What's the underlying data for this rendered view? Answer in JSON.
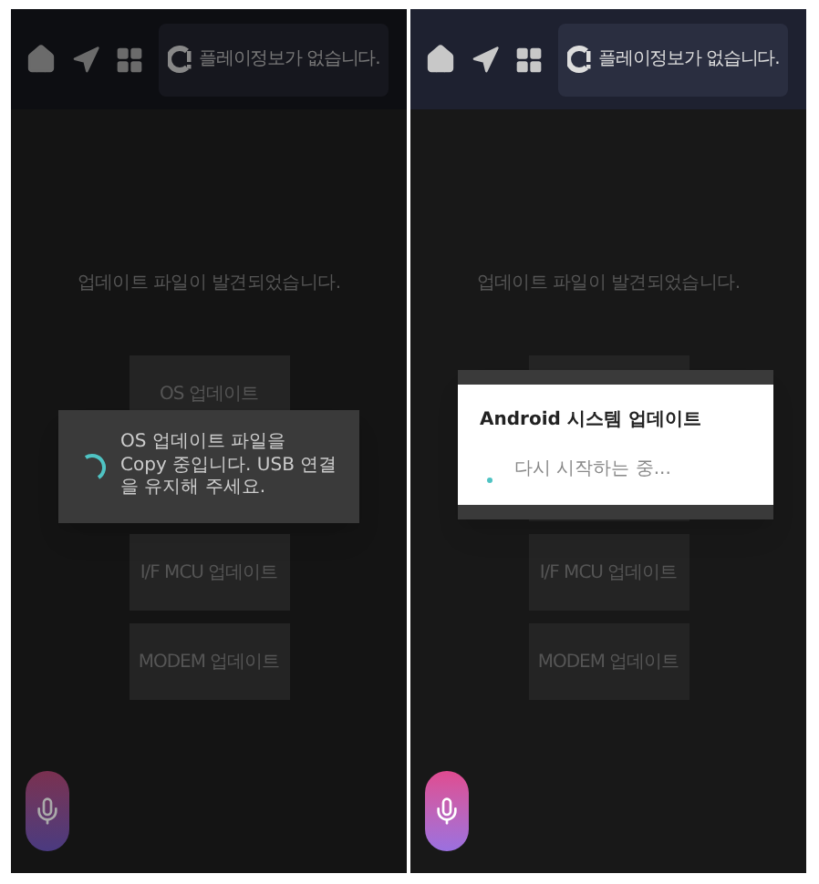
{
  "panels": [
    {
      "dimmed": true,
      "status": "플레이정보가 없습니다.",
      "message": "업데이트 파일이 발견되었습니다.",
      "buttons": [
        {
          "label": "OS 업데이트"
        },
        {
          "label": "I/F MCU 업데이트"
        },
        {
          "label": "MODEM 업데이트"
        }
      ],
      "overlay": {
        "kind": "toast",
        "text": "OS 업데이트 파일을 Copy 중입니다. USB 연결을 유지해 주세요."
      }
    },
    {
      "dimmed": false,
      "status": "플레이정보가 없습니다.",
      "message": "업데이트 파일이 발견되었습니다.",
      "buttons": [
        {
          "label": "I/F MCU 업데이트"
        },
        {
          "label": "MODEM 업데이트"
        }
      ],
      "overlay": {
        "kind": "dialog",
        "title": "Android 시스템 업데이트",
        "text": "다시 시작하는 중..."
      }
    }
  ]
}
